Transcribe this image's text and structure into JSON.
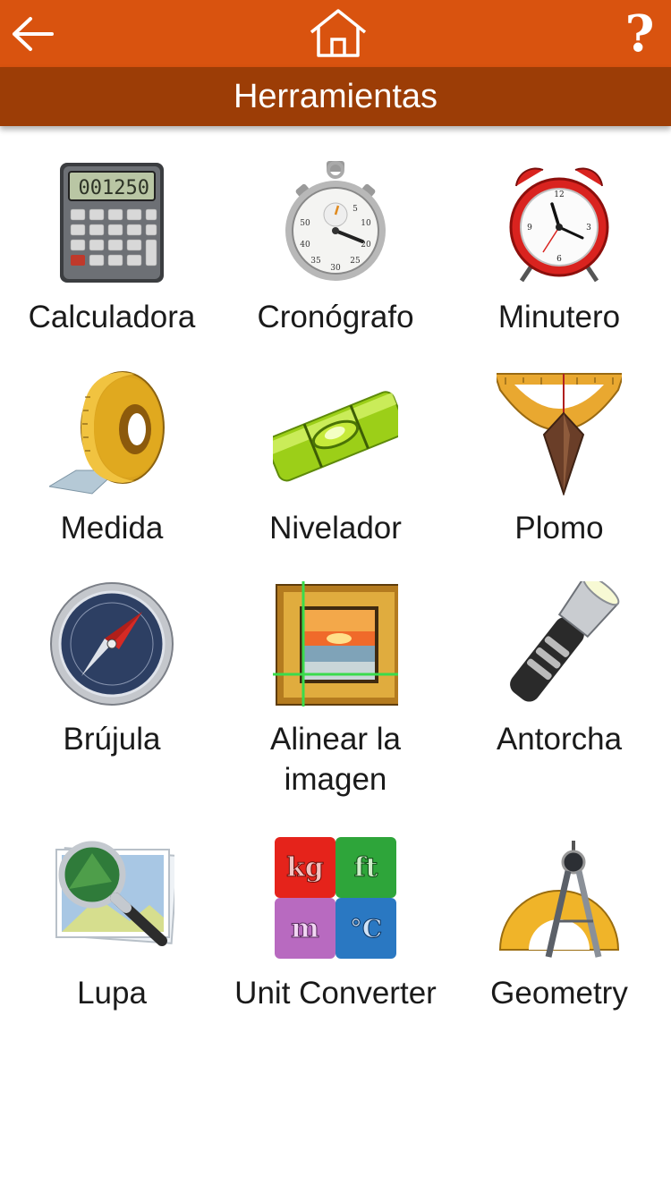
{
  "header": {
    "title": "Herramientas",
    "help_glyph": "?",
    "bar_color": "#d9530f",
    "title_bar_color": "#9c3d06"
  },
  "tools": [
    {
      "label": "Calculadora",
      "icon": "calculator-icon",
      "display": "001250"
    },
    {
      "label": "Cronógrafo",
      "icon": "stopwatch-icon"
    },
    {
      "label": "Minutero",
      "icon": "alarm-clock-icon"
    },
    {
      "label": "Medida",
      "icon": "tape-measure-icon"
    },
    {
      "label": "Nivelador",
      "icon": "spirit-level-icon"
    },
    {
      "label": "Plomo",
      "icon": "plumb-bob-icon"
    },
    {
      "label": "Brújula",
      "icon": "compass-icon"
    },
    {
      "label": "Alinear la imagen",
      "icon": "picture-frame-icon"
    },
    {
      "label": "Antorcha",
      "icon": "flashlight-icon"
    },
    {
      "label": "Lupa",
      "icon": "magnifier-icon"
    },
    {
      "label": "Unit Converter",
      "icon": "unit-converter-icon",
      "units": [
        "kg",
        "ft",
        "m",
        "°C"
      ]
    },
    {
      "label": "Geometry",
      "icon": "geometry-icon"
    }
  ]
}
